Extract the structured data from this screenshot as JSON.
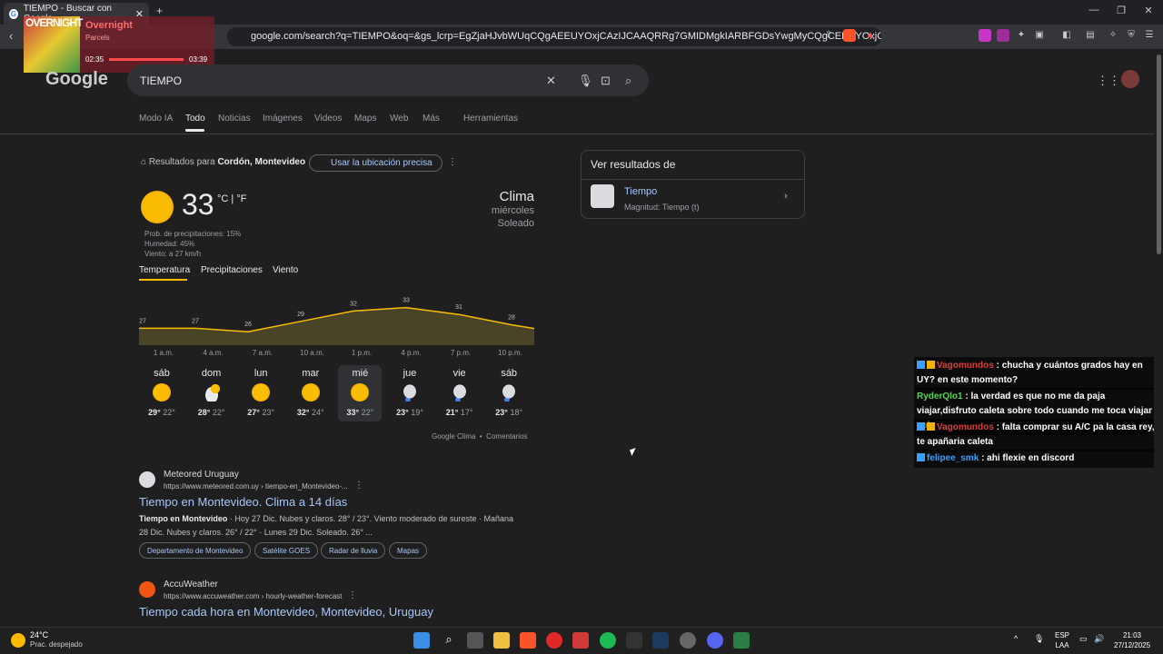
{
  "browser": {
    "tab_title": "TIEMPO - Buscar con Google",
    "url": "google.com/search?q=TIEMPO&oq=&gs_lcrp=EgZjaHJvbWUqCQgAEEUYOxjCAzIJCAAQRRg7GMIDMgkIARBFGDsYwgMyCQgCEEUYOxjCAzIJCAMQR..."
  },
  "overlay": {
    "art_text": "OVERNIGHT",
    "track": "Overnight",
    "artist": "Parcels",
    "time_elapsed": "02:35",
    "time_total": "03:39"
  },
  "google": {
    "logo": "Google",
    "query": "TIEMPO",
    "tabs": [
      "Modo IA",
      "Todo",
      "Noticias",
      "Imágenes",
      "Videos",
      "Maps",
      "Web",
      "Más",
      "Herramientas"
    ],
    "location_prefix": "Resultados para",
    "location": "Cordón, Montevideo",
    "precise_location": "Usar la ubicación precisa"
  },
  "weather": {
    "temp": "33",
    "unit": "°C | °F",
    "precip": "Prob. de precipitaciones: 15%",
    "humidity": "Humedad: 45%",
    "wind": "Viento: a 27 km/h",
    "title": "Clima",
    "day": "miércoles",
    "condition": "Soleado",
    "tabs": [
      "Temperatura",
      "Precipitaciones",
      "Viento"
    ],
    "hours": [
      "1 a.m.",
      "4 a.m.",
      "7 a.m.",
      "10 a.m.",
      "1 p.m.",
      "4 p.m.",
      "7 p.m.",
      "10 p.m."
    ],
    "days": [
      {
        "name": "sáb",
        "hi": "29°",
        "lo": "22°",
        "icon": "sun"
      },
      {
        "name": "dom",
        "hi": "28°",
        "lo": "22°",
        "icon": "partly-cloudy"
      },
      {
        "name": "lun",
        "hi": "27°",
        "lo": "23°",
        "icon": "sun"
      },
      {
        "name": "mar",
        "hi": "32°",
        "lo": "24°",
        "icon": "sun"
      },
      {
        "name": "mié",
        "hi": "33°",
        "lo": "22°",
        "icon": "sun"
      },
      {
        "name": "jue",
        "hi": "23°",
        "lo": "19°",
        "icon": "rain"
      },
      {
        "name": "vie",
        "hi": "21°",
        "lo": "17°",
        "icon": "rain"
      },
      {
        "name": "sáb",
        "hi": "23°",
        "lo": "18°",
        "icon": "rain"
      }
    ],
    "footer_source": "Google Clima",
    "footer_comments": "Comentarios"
  },
  "chart_data": {
    "type": "area",
    "x": [
      "1 a.m.",
      "4 a.m.",
      "7 a.m.",
      "10 a.m.",
      "1 p.m.",
      "4 p.m.",
      "7 p.m.",
      "10 p.m."
    ],
    "values": [
      27,
      27,
      26,
      29,
      32,
      33,
      31,
      28
    ],
    "ylabel": "°C"
  },
  "results": [
    {
      "site": "Meteored Uruguay",
      "url": "https://www.meteored.com.uy › tiempo-en_Montevideo-...",
      "title": "Tiempo en Montevideo. Clima a 14 días",
      "snippet_bold": "Tiempo en Montevideo",
      "snippet": " · Hoy 27 Dic. Nubes y claros. 28° / 23°. Viento moderado de sureste · Mañana",
      "snippet2": "28 Dic. Nubes y claros. 26° / 22° · Lunes 29 Dic. Soleado. 26° ...",
      "chips": [
        "Departamento de Montevideo",
        "Satélite GOES",
        "Radar de lluvia",
        "Mapas"
      ]
    },
    {
      "site": "AccuWeather",
      "url": "https://www.accuweather.com › hourly-weather-forecast",
      "title": "Tiempo cada hora en Montevideo, Montevideo, Uruguay"
    }
  ],
  "panel": {
    "title": "Ver resultados de",
    "item": "Tiempo",
    "sub": "Magnitud: Tiempo (t)"
  },
  "chat": [
    {
      "user": "Vagomundos",
      "msg": "chucha y cuántos grados hay en UY? en este momento?"
    },
    {
      "user": "RyderQlo1",
      "msg": "la verdad es que no me da paja viajar,disfruto caleta sobre todo cuando me toca viajar solo"
    },
    {
      "user": "Vagomundos",
      "msg": "falta comprar su A/C pa la casa rey, te apañaria caleta"
    },
    {
      "user": "felipee_smk",
      "msg": "ahi flexie en discord"
    }
  ],
  "taskbar": {
    "weather_temp": "24°C",
    "weather_desc": "Prac. despejado",
    "lang": "ESP",
    "lang2": "LAA",
    "time": "21:03",
    "date": "27/12/2025"
  }
}
